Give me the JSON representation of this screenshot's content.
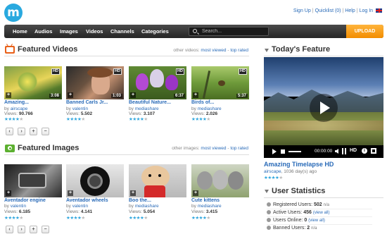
{
  "logo": {
    "letter": "m"
  },
  "toplinks": {
    "signup": "Sign Up",
    "quicklist": "Quicklist (0)",
    "help": "Help",
    "login": "Log In",
    "sep": "|"
  },
  "nav": {
    "items": [
      "Home",
      "Audios",
      "Images",
      "Videos",
      "Channels",
      "Categories"
    ],
    "search_placeholder": "Search...",
    "upload": "UPLOAD"
  },
  "featured_videos": {
    "title": "Featured Videos",
    "other_prefix": "other videos:",
    "most_viewed": "most viewed",
    "dash": "-",
    "top_rated": "top rated",
    "items": [
      {
        "title": "Amazing...",
        "by": "by",
        "author": "airscape",
        "views_label": "Views:",
        "views": "90.766",
        "duration": "3:08",
        "hd": "HD",
        "rating": 4
      },
      {
        "title": "Banned Carls Jr...",
        "by": "by",
        "author": "valentin",
        "views_label": "Views:",
        "views": "5.502",
        "duration": "1:03",
        "hd": "HD",
        "rating": 4
      },
      {
        "title": "Beautiful Nature...",
        "by": "by",
        "author": "mediashare",
        "views_label": "Views:",
        "views": "3.107",
        "duration": "6:37",
        "hd": "HD",
        "rating": 4
      },
      {
        "title": "Birds of...",
        "by": "by",
        "author": "mediashare",
        "views_label": "Views:",
        "views": "2.026",
        "duration": "5:37",
        "hd": "HD",
        "rating": 4
      }
    ]
  },
  "featured_images": {
    "title": "Featured Images",
    "other_prefix": "other images:",
    "most_viewed": "most viewed",
    "dash": "-",
    "top_rated": "top rated",
    "items": [
      {
        "title": "Aventador engine",
        "by": "by",
        "author": "valentin",
        "views_label": "Views:",
        "views": "6.185",
        "rating": 4
      },
      {
        "title": "Aventador wheels",
        "by": "by",
        "author": "valentin",
        "views_label": "Views:",
        "views": "4.141",
        "rating": 4
      },
      {
        "title": "Boo the...",
        "by": "by",
        "author": "mediashare",
        "views_label": "Views:",
        "views": "5.054",
        "rating": 4
      },
      {
        "title": "Cute kittens",
        "by": "by",
        "author": "mediashare",
        "views_label": "Views:",
        "views": "3.415",
        "rating": 4
      }
    ]
  },
  "pager": {
    "first": "‹",
    "next": "›",
    "add": "+",
    "remove": "−"
  },
  "todays_feature": {
    "title": "Today's Feature",
    "video_title": "Amazing Timelapse HD",
    "author": "airscape",
    "meta": ", 1036 day(s) ago",
    "time": "00:00:00",
    "hd": "HD",
    "rating": 4
  },
  "stats": {
    "title": "User Statistics",
    "rows": [
      {
        "label": "Registered Users:",
        "value": "502",
        "extra": "n/a",
        "link": ""
      },
      {
        "label": "Active Users:",
        "value": "456",
        "extra": "",
        "link": "(view all)"
      },
      {
        "label": "Users Online:",
        "value": "0",
        "extra": "",
        "link": "(view all)"
      },
      {
        "label": "Banned Users:",
        "value": "2",
        "extra": "n/a",
        "link": ""
      }
    ]
  },
  "colors": {
    "accent": "#2a6bb8",
    "logo": "#29a9df",
    "upload": "#f28d00",
    "video_icon": "#e8611a",
    "image_icon": "#5cb030"
  }
}
